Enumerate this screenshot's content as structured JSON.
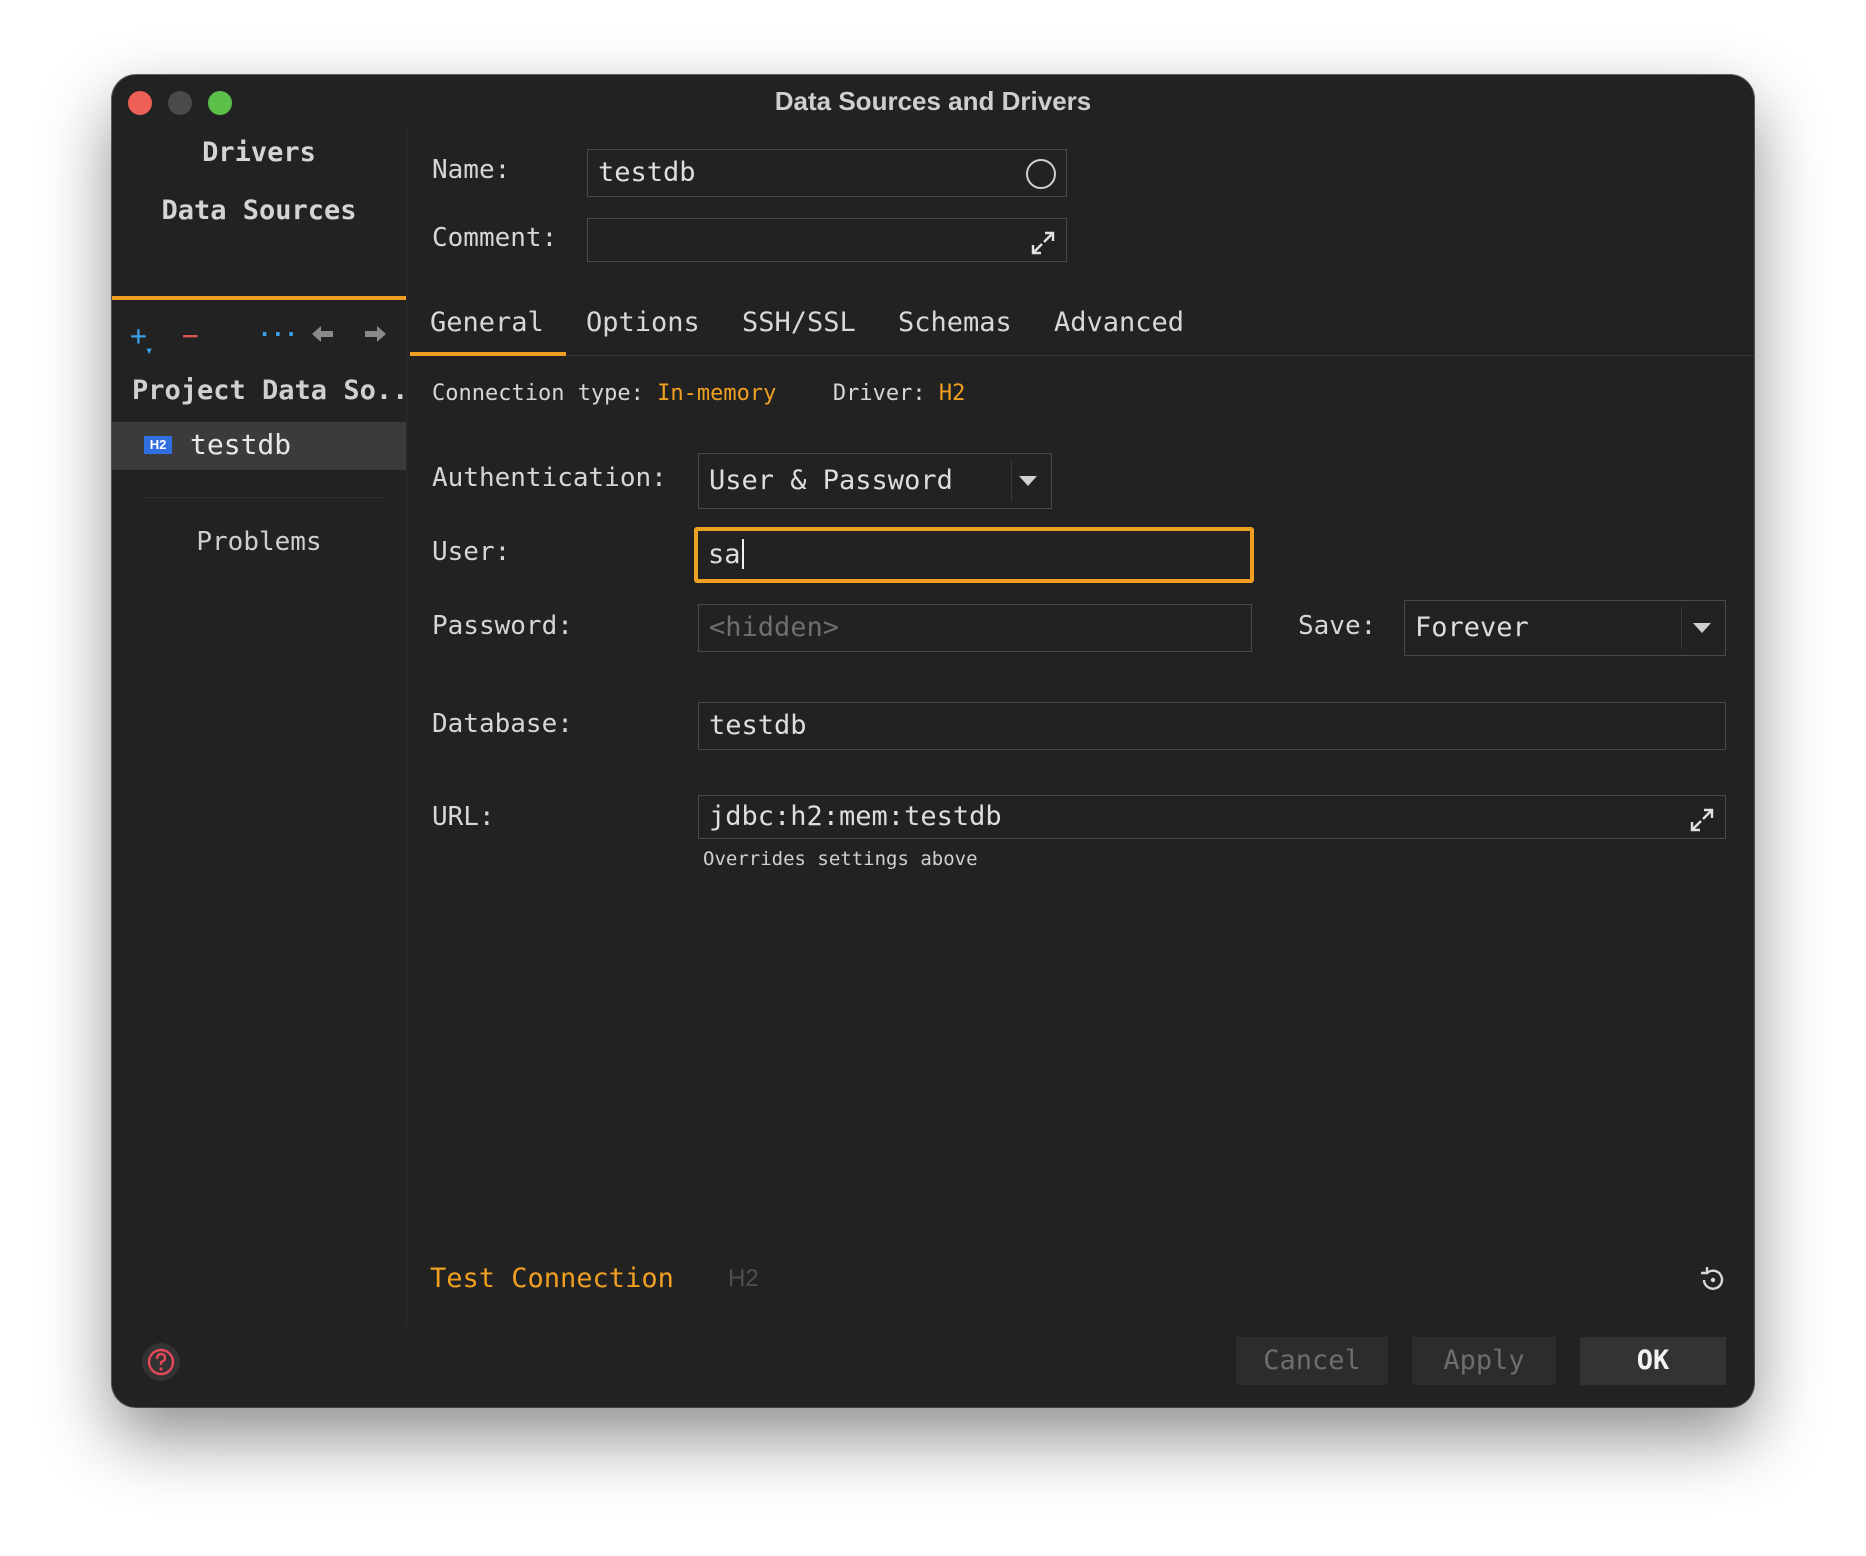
{
  "window": {
    "title": "Data Sources and Drivers"
  },
  "sidebar": {
    "tabs": [
      "Drivers",
      "Data Sources"
    ],
    "toolbar": {
      "add": "+",
      "remove": "−",
      "more": "···",
      "back": "🡐",
      "forward": "🡒"
    },
    "group_label": "Project Data So..",
    "items": [
      {
        "badge": "H2",
        "label": "testdb"
      }
    ],
    "problems_label": "Problems"
  },
  "form": {
    "name_label": "Name:",
    "name_value": "testdb",
    "comment_label": "Comment:",
    "comment_value": "",
    "tabs": [
      "General",
      "Options",
      "SSH/SSL",
      "Schemas",
      "Advanced"
    ],
    "active_tab": "General",
    "connection_type_label": "Connection type:",
    "connection_type_value": "In-memory",
    "driver_label": "Driver:",
    "driver_value": "H2",
    "auth_label": "Authentication:",
    "auth_value": "User & Password",
    "user_label": "User:",
    "user_value": "sa",
    "password_label": "Password:",
    "password_placeholder": "<hidden>",
    "save_label": "Save:",
    "save_value": "Forever",
    "database_label": "Database:",
    "database_value": "testdb",
    "url_label": "URL:",
    "url_value": "jdbc:h2:mem:testdb",
    "url_hint": "Overrides settings above",
    "test_connection": "Test Connection",
    "driver_status": "H2"
  },
  "footer": {
    "cancel": "Cancel",
    "apply": "Apply",
    "ok": "OK"
  },
  "colors": {
    "accent": "#f0a020",
    "background": "#222222",
    "selected": "#3b3b3b",
    "badge": "#2f6fe0"
  }
}
